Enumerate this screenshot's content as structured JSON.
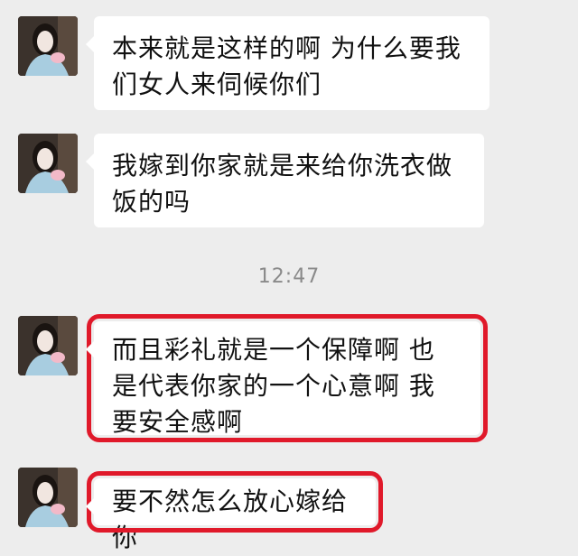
{
  "messages": [
    {
      "text": "本来就是这样的啊 为什么要我们女人来伺候你们",
      "avatar_icon": "user-avatar-woman-photo"
    },
    {
      "text": "我嫁到你家就是来给你洗衣做饭的吗",
      "avatar_icon": "user-avatar-woman-photo"
    },
    {
      "text": "而且彩礼就是一个保障啊  也是代表你家的一个心意啊  我要安全感啊",
      "avatar_icon": "user-avatar-woman-photo",
      "highlighted": true
    },
    {
      "text": "要不然怎么放心嫁给你",
      "avatar_icon": "user-avatar-woman-photo",
      "highlighted": true
    }
  ],
  "timestamp": "12:47",
  "colors": {
    "background": "#ededed",
    "bubble": "#ffffff",
    "highlight": "#e0192a",
    "timestamp": "#8a8a8a"
  }
}
